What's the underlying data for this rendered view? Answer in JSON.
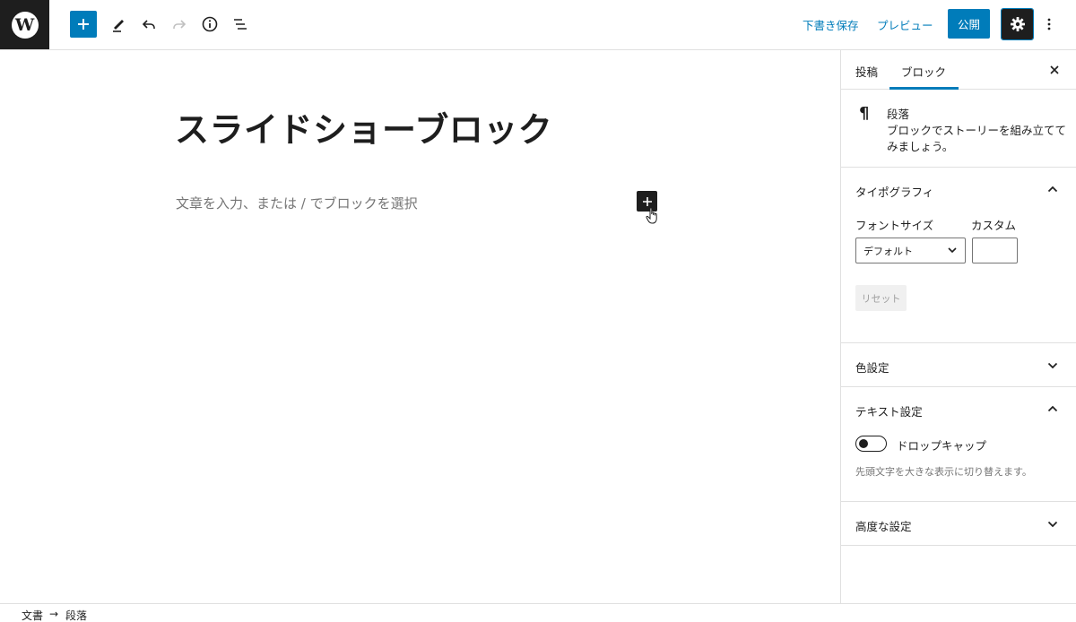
{
  "header": {
    "logo_letter": "W",
    "icons": [
      "wordpress-logo-icon",
      "plus-icon",
      "pencil-icon",
      "undo-icon",
      "redo-icon",
      "info-icon",
      "list-view-icon",
      "gear-icon",
      "more-vertical-icon"
    ],
    "save_draft_label": "下書き保存",
    "preview_label": "プレビュー",
    "publish_label": "公開"
  },
  "editor": {
    "title": "スライドショーブロック",
    "placeholder": "文章を入力、または / でブロックを選択"
  },
  "sidebar": {
    "tabs": [
      {
        "label": "投稿"
      },
      {
        "label": "ブロック"
      }
    ],
    "active_tab": "ブロック",
    "block": {
      "icon": "¶",
      "name": "段落",
      "description": "ブロックでストーリーを組み立ててみましょう。"
    },
    "typography": {
      "title": "タイポグラフィ",
      "font_size_label": "フォントサイズ",
      "custom_label": "カスタム",
      "font_size_value": "デフォルト",
      "reset_label": "リセット"
    },
    "color": {
      "title": "色設定"
    },
    "text_settings": {
      "title": "テキスト設定",
      "dropcap_label": "ドロップキャップ",
      "dropcap_help": "先頭文字を大きな表示に切り替えます。"
    },
    "advanced": {
      "title": "高度な設定"
    }
  },
  "footer": {
    "crumbs": [
      "文書",
      "段落"
    ],
    "separator": "→"
  },
  "colors": {
    "accent": "#007cba",
    "dark": "#1e1e1e",
    "muted": "#757575"
  }
}
